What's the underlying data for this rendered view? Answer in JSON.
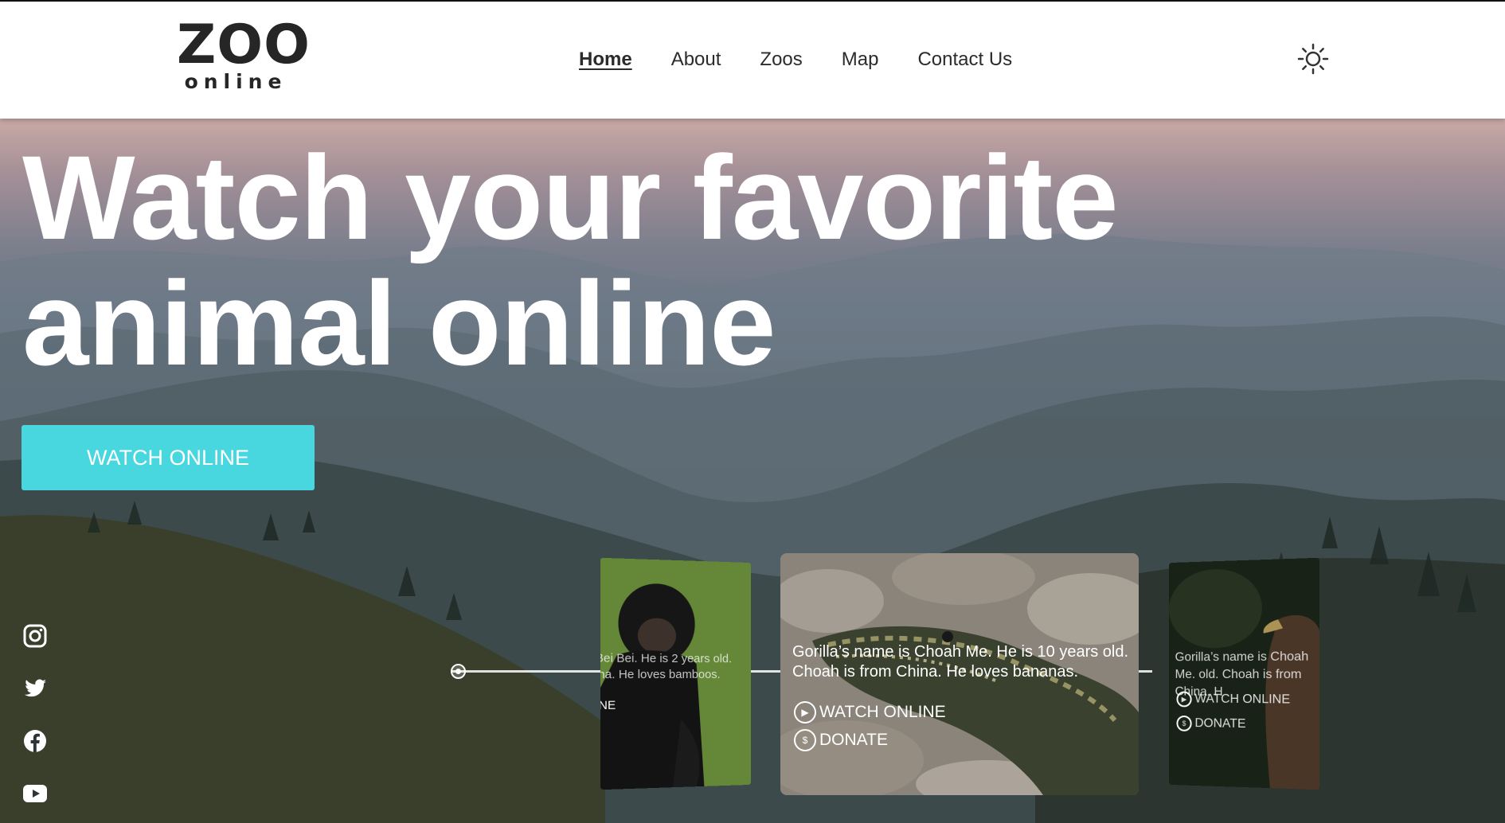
{
  "logo": {
    "main": "ZOO",
    "sub": "online"
  },
  "nav": {
    "home": "Home",
    "about": "About",
    "zoos": "Zoos",
    "map": "Map",
    "contact": "Contact Us"
  },
  "hero": {
    "title": "Watch your favorite animal online",
    "button": "WATCH ONLINE"
  },
  "cards": {
    "left": {
      "text": "Bei Bei. He is 2 years old. ina. He loves bamboos.",
      "watch_fragment": "NE"
    },
    "center": {
      "text": "Gorilla’s name is Choah Me. He is 10 years old. Choah is from China. He loves bananas.",
      "watch": "WATCH ONLINE",
      "donate": "DONATE"
    },
    "right": {
      "text": "Gorilla’s name is Choah Me. old. Choah is from China. H",
      "watch": "WATCH ONLINE",
      "donate": "DONATE"
    }
  },
  "social": [
    "instagram-icon",
    "twitter-icon",
    "facebook-icon",
    "youtube-icon"
  ],
  "colors": {
    "accent": "#48d6df",
    "header_bg": "#ffffff",
    "text_dark": "#262626"
  }
}
